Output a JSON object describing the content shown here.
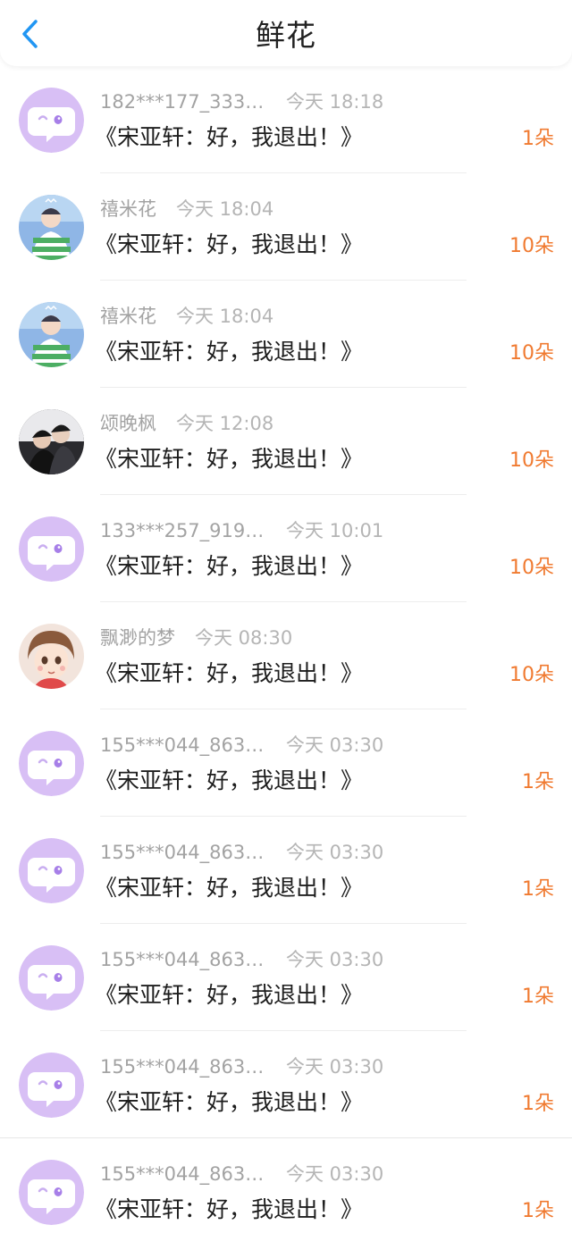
{
  "header": {
    "title": "鲜花",
    "back_icon": "chevron-left-icon",
    "back_color": "#2196f3"
  },
  "colors": {
    "count": "#f07a30",
    "default_avatar_bg": "#d8bff5",
    "name_gray": "#a3a3a3"
  },
  "items": [
    {
      "name": "182***177_3334...",
      "time": "今天 18:18",
      "message": "《宋亚轩：好，我退出！》",
      "count": "1朵",
      "avatar": "default-chat-avatar"
    },
    {
      "name": "禧米花",
      "time": "今天 18:04",
      "message": "《宋亚轩：好，我退出！》",
      "count": "10朵",
      "avatar": "photo-avatar-green"
    },
    {
      "name": "禧米花",
      "time": "今天 18:04",
      "message": "《宋亚轩：好，我退出！》",
      "count": "10朵",
      "avatar": "photo-avatar-green"
    },
    {
      "name": "颂晚枫",
      "time": "今天 12:08",
      "message": "《宋亚轩：好，我退出！》",
      "count": "10朵",
      "avatar": "photo-avatar-dark"
    },
    {
      "name": "133***257_9199...",
      "time": "今天 10:01",
      "message": "《宋亚轩：好，我退出！》",
      "count": "10朵",
      "avatar": "default-chat-avatar"
    },
    {
      "name": "飘渺的梦",
      "time": "今天 08:30",
      "message": "《宋亚轩：好，我退出！》",
      "count": "10朵",
      "avatar": "cartoon-avatar"
    },
    {
      "name": "155***044_8638...",
      "time": "今天 03:30",
      "message": "《宋亚轩：好，我退出！》",
      "count": "1朵",
      "avatar": "default-chat-avatar"
    },
    {
      "name": "155***044_8638...",
      "time": "今天 03:30",
      "message": "《宋亚轩：好，我退出！》",
      "count": "1朵",
      "avatar": "default-chat-avatar"
    },
    {
      "name": "155***044_8638...",
      "time": "今天 03:30",
      "message": "《宋亚轩：好，我退出！》",
      "count": "1朵",
      "avatar": "default-chat-avatar"
    },
    {
      "name": "155***044_8638...",
      "time": "今天 03:30",
      "message": "《宋亚轩：好，我退出！》",
      "count": "1朵",
      "avatar": "default-chat-avatar"
    },
    {
      "name": "155***044_8638...",
      "time": "今天 03:30",
      "message": "《宋亚轩：好，我退出！》",
      "count": "1朵",
      "avatar": "default-chat-avatar"
    }
  ]
}
